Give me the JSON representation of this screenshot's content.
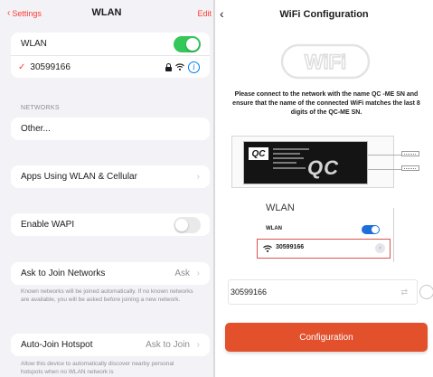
{
  "left": {
    "nav": {
      "back_label": "Settings",
      "title": "WLAN",
      "edit_label": "Edit"
    },
    "wlan_row": {
      "label": "WLAN",
      "toggle_on": true
    },
    "connected_network": {
      "check": "✓",
      "name": "30599166"
    },
    "networks_header": "NETWORKS",
    "other_label": "Other...",
    "apps_row": {
      "label": "Apps Using WLAN & Cellular"
    },
    "wapi_row": {
      "label": "Enable WAPI",
      "toggle_on": false
    },
    "ask_join": {
      "label": "Ask to Join Networks",
      "value": "Ask",
      "note": "Known networks will be joined automatically. If no known networks are available, you will be asked before joining a new network."
    },
    "auto_join": {
      "label": "Auto-Join Hotspot",
      "value": "Ask to Join",
      "note": "Allow this device to automatically discover nearby personal hotspots when no WLAN network is"
    },
    "colors": {
      "accent": "#ff3b30",
      "toggle_on": "#34c759",
      "info": "#007aff"
    }
  },
  "right": {
    "nav": {
      "title": "WiFi Configuration"
    },
    "logo_text": "WiFi",
    "instruction": "Please connect to the network with the name QC -ME SN and ensure that the name of the connected WiFi matches the last 8 digits of the QC-ME SN.",
    "device": {
      "logo": "QC",
      "watermark": "QC"
    },
    "inset": {
      "title": "WLAN",
      "wlan_label": "WLAN",
      "network_name": "30599166"
    },
    "ssid_value": "30599166",
    "config_button": "Configuration",
    "colors": {
      "button": "#e2502c",
      "highlight_border": "#d9534f",
      "inset_toggle": "#1e6fd9"
    }
  },
  "icons": {
    "back": "chevron-left-icon",
    "lock": "lock-icon",
    "wifi": "wifi-icon",
    "info": "info-icon",
    "chevron": "chevron-right-icon",
    "swap": "swap-icon"
  }
}
